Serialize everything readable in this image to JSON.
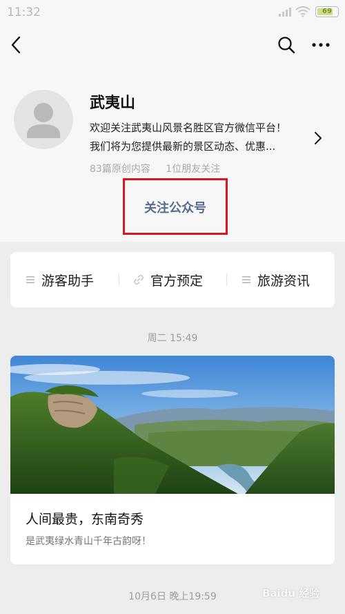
{
  "status_bar": {
    "time": "11:32",
    "battery_level": "69",
    "battery_fraction": 0.69
  },
  "nav": {
    "back_icon": "back-chevron-icon",
    "search_icon": "search-icon",
    "more_icon": "more-dots-icon"
  },
  "profile": {
    "name": "武夷山",
    "description_line1": "欢迎关注武夷山风景名胜区官方微信平台！",
    "description_line2": "我们将为您提供最新的景区动态、优惠...",
    "original_count": "83篇原创内容",
    "friends_following": "1位朋友关注",
    "follow_label": "关注公众号",
    "avatar_icon": "default-avatar-icon",
    "highlight_color": "#d7191f"
  },
  "menu": [
    {
      "label": "游客助手",
      "icon": "list-icon"
    },
    {
      "label": "官方预定",
      "icon": "link-icon"
    },
    {
      "label": "旅游资讯",
      "icon": "list-icon"
    }
  ],
  "feed": {
    "timestamp_1": "周二 15:49",
    "article": {
      "title": "人间最贵，东南奇秀",
      "digest": "是武夷绿水青山千年古韵呀！",
      "cover_icon": "landscape-photo"
    },
    "timestamp_2": "10月6日 晚上19:59"
  },
  "watermark": "Baidu 经验"
}
